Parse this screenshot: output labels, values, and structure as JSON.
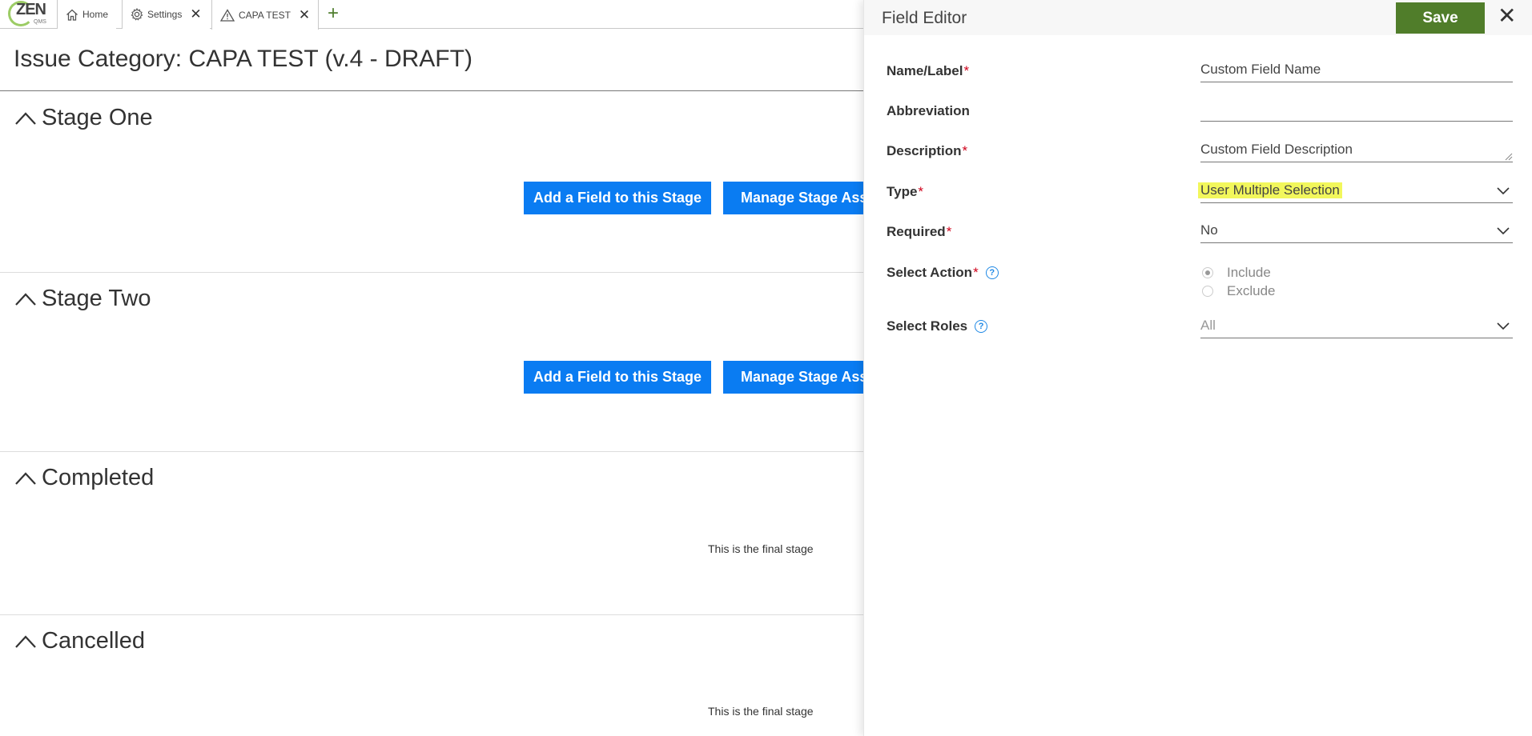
{
  "tabs": {
    "logo_text": "ZEN",
    "logo_sub": "QMS",
    "items": [
      {
        "label": "Home",
        "icon": "home-icon"
      },
      {
        "label": "Settings",
        "icon": "gear-icon"
      },
      {
        "label": "CAPA TEST",
        "icon": "warning-icon"
      }
    ],
    "close_glyph": "✕",
    "add_glyph": "+"
  },
  "page": {
    "title": "Issue Category: CAPA TEST (v.4 - DRAFT)"
  },
  "stages": [
    {
      "name": "Stage One",
      "add_button": "Add a Field to this Stage",
      "manage_button": "Manage Stage Assi"
    },
    {
      "name": "Stage Two",
      "add_button": "Add a Field to this Stage",
      "manage_button": "Manage Stage Assi"
    },
    {
      "name": "Completed",
      "note": "This is the final stage"
    },
    {
      "name": "Cancelled",
      "note": "This is the final stage"
    }
  ],
  "field_editor": {
    "title": "Field Editor",
    "save_label": "Save",
    "close_glyph": "✕",
    "fields": {
      "name": {
        "label": "Name/Label",
        "value": "Custom Field Name",
        "required": "*"
      },
      "abbreviation": {
        "label": "Abbreviation",
        "value": ""
      },
      "description": {
        "label": "Description",
        "value": "Custom Field Description",
        "required": "*"
      },
      "type": {
        "label": "Type",
        "value": "User Multiple Selection",
        "required": "*"
      },
      "required": {
        "label": "Required",
        "value": "No",
        "required": "*"
      },
      "select_action": {
        "label": "Select Action",
        "required": "*",
        "options": [
          "Include",
          "Exclude"
        ],
        "selected": "Include"
      },
      "select_roles": {
        "label": "Select Roles",
        "value": "All"
      }
    },
    "help_glyph": "?",
    "colors": {
      "save": "#507d2a",
      "primary_button": "#0a7cf2",
      "highlight": "#f2f75c",
      "required": "#d0021b"
    }
  }
}
